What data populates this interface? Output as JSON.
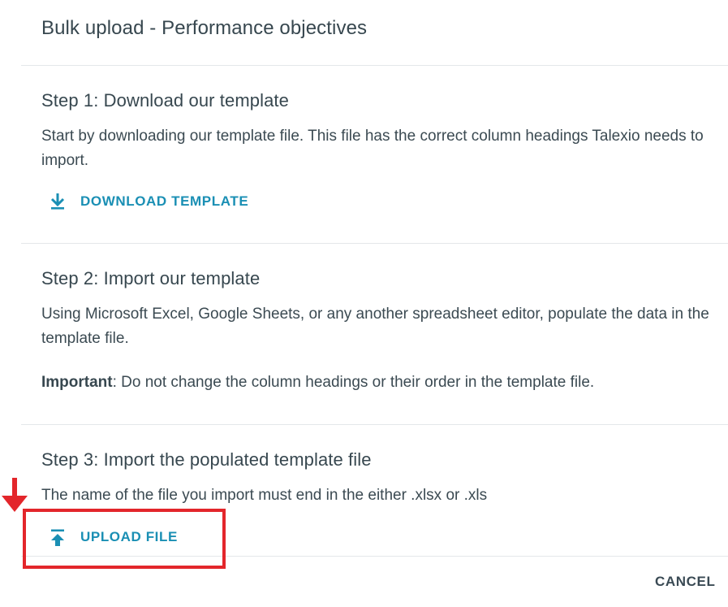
{
  "dialog": {
    "title": "Bulk upload - Performance objectives"
  },
  "steps": [
    {
      "title": "Step 1: Download our template",
      "text": "Start by downloading our template file. This file has the correct column headings Talexio needs to import.",
      "action_label": "DOWNLOAD TEMPLATE",
      "action_icon": "download-icon"
    },
    {
      "title": "Step 2: Import our template",
      "text": "Using Microsoft Excel, Google Sheets, or any another spreadsheet editor, populate the data in the template file.",
      "important_label": "Important",
      "important_text": ": Do not change the column headings or their order in the template file."
    },
    {
      "title": "Step 3: Import the populated template file",
      "text": "The name of the file you import must end in the either .xlsx or .xls",
      "action_label": "UPLOAD FILE",
      "action_icon": "upload-icon"
    }
  ],
  "footer": {
    "cancel_label": "CANCEL"
  },
  "colors": {
    "accent": "#1a8fb4",
    "text": "#37474f",
    "divider": "#e4e7ea",
    "annotation": "#e3262b"
  }
}
